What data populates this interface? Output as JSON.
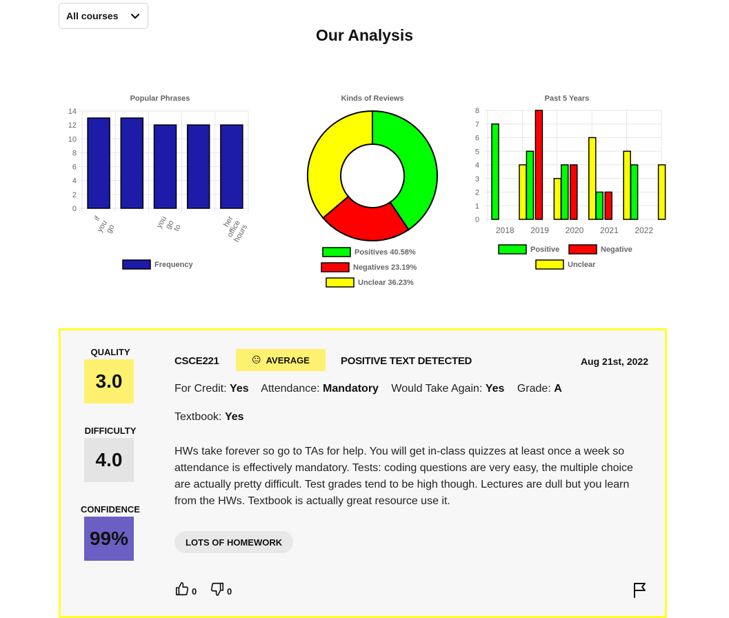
{
  "course_filter": {
    "selected": "All courses",
    "icon": "chevron-down-icon"
  },
  "page_title": "Our Analysis",
  "charts": {
    "phrases": {
      "title": "Popular Phrases",
      "legend": "Frequency",
      "color": "#1c1ca8"
    },
    "kinds": {
      "title": "Kinds of Reviews",
      "legend": [
        "Positives 40.58%",
        "Negatives 23.19%",
        "Unclear 36.23%"
      ]
    },
    "years": {
      "title": "Past 5 Years",
      "legend": [
        "Positive",
        "Negative",
        "Unclear"
      ]
    }
  },
  "chart_data": [
    {
      "type": "bar",
      "title": "Popular Phrases",
      "categories": [
        [
          "if",
          "you",
          "go"
        ],
        [
          "you",
          "go",
          "to"
        ],
        [
          "her",
          "office",
          "hours"
        ]
      ],
      "series": [
        {
          "name": "Frequency",
          "values": [
            13,
            13,
            12,
            12,
            12
          ]
        }
      ],
      "ylim": [
        0,
        14
      ],
      "yticks": [
        0,
        2,
        4,
        6,
        8,
        10,
        12,
        14
      ],
      "grid": true,
      "legend": "bottom"
    },
    {
      "type": "pie",
      "title": "Kinds of Reviews",
      "donut": true,
      "slices": [
        {
          "name": "Positives",
          "value": 40.58,
          "color": "#00ff00"
        },
        {
          "name": "Negatives",
          "value": 23.19,
          "color": "#ff0000"
        },
        {
          "name": "Unclear",
          "value": 36.23,
          "color": "#ffff00"
        }
      ],
      "legend": "bottom"
    },
    {
      "type": "bar",
      "title": "Past 5 Years",
      "categories": [
        "2018",
        "2019",
        "2020",
        "2021",
        "2022"
      ],
      "series": [
        {
          "name": "Positive",
          "values": [
            7,
            5,
            4,
            2,
            4
          ],
          "color": "#00ff00"
        },
        {
          "name": "Negative",
          "values": [
            0,
            8,
            4,
            2,
            0
          ],
          "color": "#ff0000"
        },
        {
          "name": "Unclear",
          "values": [
            4,
            3,
            6,
            5,
            4
          ],
          "color": "#ffff00"
        }
      ],
      "ylim": [
        0,
        8
      ],
      "yticks": [
        0,
        1,
        2,
        3,
        4,
        5,
        6,
        7,
        8
      ],
      "grid": true,
      "legend": "bottom"
    }
  ],
  "review": {
    "quality": {
      "label": "QUALITY",
      "value": "3.0",
      "color": "#fff170"
    },
    "difficulty": {
      "label": "DIFFICULTY",
      "value": "4.0",
      "color": "#e4e4e4"
    },
    "confidence": {
      "label": "CONFIDENCE",
      "value": "99%",
      "color": "#6b5fc4"
    },
    "course_code": "CSCE221",
    "emotion": {
      "emoji": "😐",
      "label": "AVERAGE"
    },
    "sentiment": "POSITIVE TEXT DETECTED",
    "date": "Aug 21st, 2022",
    "meta": {
      "for_credit_label": "For Credit:",
      "for_credit": "Yes",
      "attendance_label": "Attendance:",
      "attendance": "Mandatory",
      "take_again_label": "Would Take Again:",
      "take_again": "Yes",
      "grade_label": "Grade:",
      "grade": "A",
      "textbook_label": "Textbook:",
      "textbook": "Yes"
    },
    "comment": "HWs take forever so go to TAs for help. You will get in-class quizzes at least once a week so attendance is effectively mandatory. Tests: coding questions are very easy, the multiple choice are actually pretty difficult. Test grades tend to be high though. Lectures are dull but you learn from the HWs. Textbook is actually great resource use it.",
    "tags": [
      "LOTS OF HOMEWORK"
    ],
    "helpful_count": "0",
    "not_helpful_count": "0",
    "icons": [
      "thumbs-up-icon",
      "thumbs-down-icon",
      "flag-icon"
    ]
  }
}
